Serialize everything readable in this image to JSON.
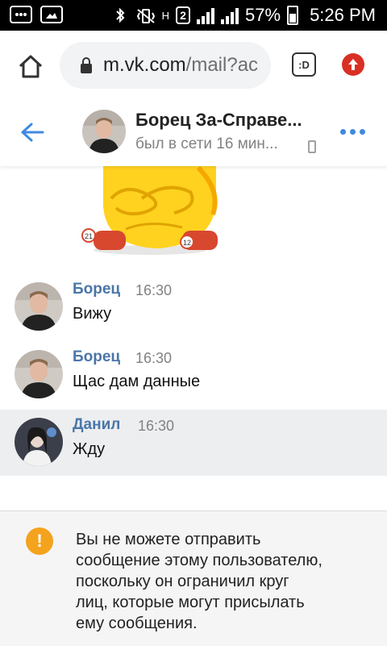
{
  "status_bar": {
    "battery_percent": "57%",
    "time": "5:26 PM",
    "network_h": "H",
    "sim_slot": "2"
  },
  "browser": {
    "url_host": "m.vk.com",
    "url_path": "/mail?ac",
    "tabs_label": ":D"
  },
  "chat": {
    "name": "Борец За-Справе...",
    "status": "был в сети 16 мин..."
  },
  "messages": [
    {
      "author": "Борец",
      "time": "16:30",
      "text": "Вижу"
    },
    {
      "author": "Борец",
      "time": "16:30",
      "text": "Щас дам данные"
    },
    {
      "author": "Данил",
      "time": "16:30",
      "text": "Жду"
    }
  ],
  "sticker": {
    "ball_left": "21",
    "ball_right": "12"
  },
  "notice": {
    "text": "Вы не можете отправить\nсообщение этому пользователю,\nпоскольку он ограничил круг\nлиц, которые могут присылать\nему сообщения."
  },
  "colors": {
    "accent": "#4a76a8",
    "warning": "#f4a31d",
    "highlight": "#edeef0"
  }
}
